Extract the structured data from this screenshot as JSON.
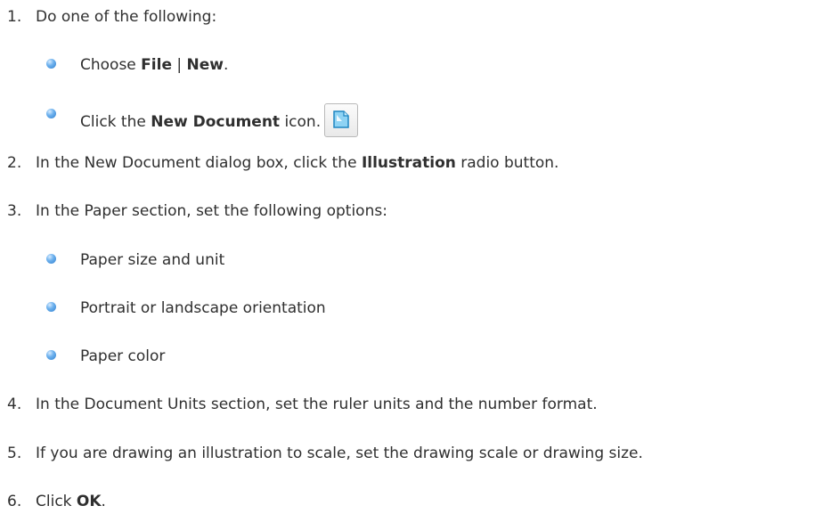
{
  "steps": [
    {
      "number": "1.",
      "text": "Do one of the following:",
      "subitems": [
        {
          "prefix": "Choose ",
          "bold1": "File",
          "mid": " | ",
          "bold2": "New",
          "suffix": "."
        },
        {
          "prefix": "Click the ",
          "bold1": "New Document",
          "suffix": " icon.",
          "icon": "new-document-icon"
        }
      ]
    },
    {
      "number": "2.",
      "prefix": "In the New Document dialog box, click the ",
      "bold": "Illustration",
      "suffix": " radio button."
    },
    {
      "number": "3.",
      "text": "In the Paper section, set the following options:",
      "subitems": [
        {
          "text": "Paper size and unit"
        },
        {
          "text": "Portrait or landscape orientation"
        },
        {
          "text": "Paper color"
        }
      ]
    },
    {
      "number": "4.",
      "text": "In the Document Units section, set the ruler units and the number format."
    },
    {
      "number": "5.",
      "text": "If you are drawing an illustration to scale, set the drawing scale or drawing size."
    },
    {
      "number": "6.",
      "prefix": "Click ",
      "bold": "OK",
      "suffix": "."
    }
  ],
  "colors": {
    "text": "#2f2f2f",
    "bullet": "#4a98e2",
    "icon_accent": "#2aa6e6"
  }
}
